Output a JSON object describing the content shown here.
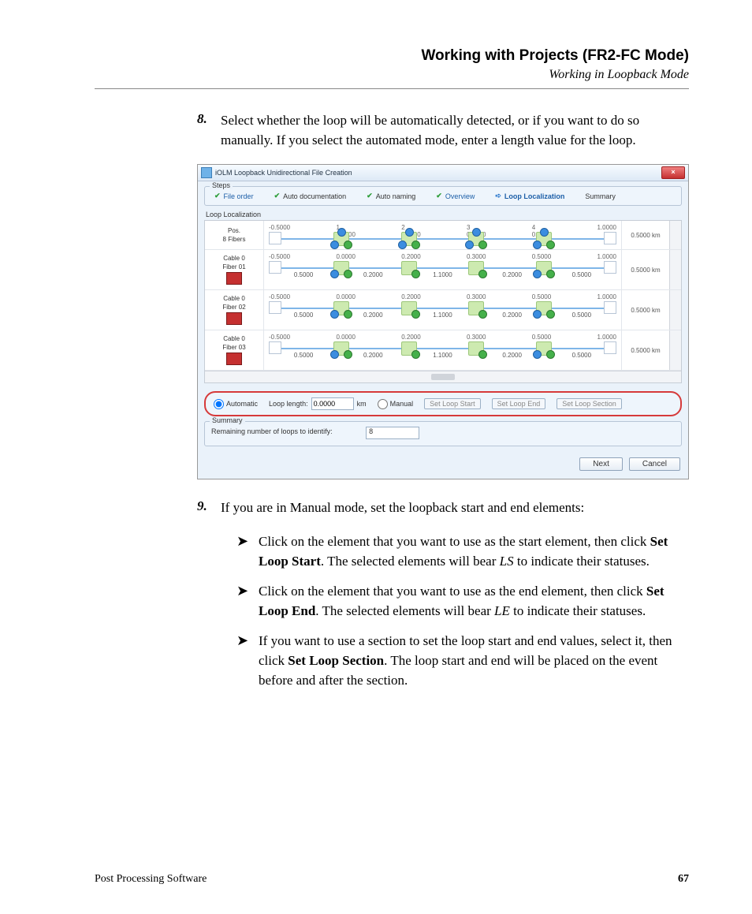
{
  "header": {
    "title": "Working with Projects (FR2-FC Mode)",
    "subtitle": "Working in Loopback Mode"
  },
  "step8": {
    "num": "8.",
    "text": "Select whether the loop will be automatically detected, or if you want to do so manually. If you select the automated mode, enter a length value for the loop."
  },
  "step9": {
    "num": "9.",
    "text": "If you are in Manual mode, set the loopback start and end elements:"
  },
  "bullets": {
    "b1a": "Click on the element that you want to use as the start element, then click ",
    "b1b": "Set Loop Start",
    "b1c": ". The selected elements will bear ",
    "b1d": "LS",
    "b1e": " to indicate their statuses.",
    "b2a": "Click on the element that you want to use as the end element, then click ",
    "b2b": "Set Loop End",
    "b2c": ". The selected elements will bear ",
    "b2d": "LE",
    "b2e": " to indicate their statuses.",
    "b3a": "If you want to use a section to set the loop start and end values, select it, then click ",
    "b3b": "Set Loop Section",
    "b3c": ". The loop start and end will be placed on the event before and after the section."
  },
  "dialog": {
    "title": "iOLM Loopback Unidirectional File Creation",
    "close": "×",
    "steps_label": "Steps",
    "tabs": {
      "t1": "File order",
      "t2": "Auto documentation",
      "t3": "Auto naming",
      "t4": "Overview",
      "t5": "Loop Localization",
      "t6": "Summary"
    },
    "loc_label": "Loop Localization",
    "pos_header": {
      "l1": "Pos.",
      "l2": "8 Fibers"
    },
    "col_idx": {
      "c1": "1",
      "c2": "2",
      "c3": "3",
      "c4": "4"
    },
    "ticks": {
      "t0": "-0.5000",
      "t1": "0.0000",
      "t2": "0.2000",
      "t3": "0.3000",
      "t4": "0.5000",
      "t5": "1.0000"
    },
    "km_pos": "0.5000 km",
    "fibers": {
      "f1": {
        "l1": "Cable 0",
        "l2": "Fiber 01"
      },
      "f2": {
        "l1": "Cable 0",
        "l2": "Fiber 02"
      },
      "f3": {
        "l1": "Cable 0",
        "l2": "Fiber 03"
      }
    },
    "row_ticks_top": {
      "a": "-0.5000",
      "b": "0.0000",
      "c": "0.2000",
      "d": "0.3000",
      "e": "0.5000",
      "f": "1.0000"
    },
    "row_vals": {
      "a": "0.5000",
      "b": "0.2000",
      "c": "1.1000",
      "d": "0.2000",
      "e": "0.5000"
    },
    "row_km": "0.5000 km",
    "controls": {
      "auto": "Automatic",
      "loop_len_label": "Loop length:",
      "loop_len_value": "0.0000",
      "unit": "km",
      "manual": "Manual",
      "btn1": "Set Loop Start",
      "btn2": "Set Loop End",
      "btn3": "Set Loop Section"
    },
    "summary": {
      "label": "Summary",
      "text": "Remaining number of loops to identify:",
      "value": "8"
    },
    "footer": {
      "next": "Next",
      "cancel": "Cancel"
    }
  },
  "footer": {
    "product": "Post Processing Software",
    "page": "67"
  }
}
